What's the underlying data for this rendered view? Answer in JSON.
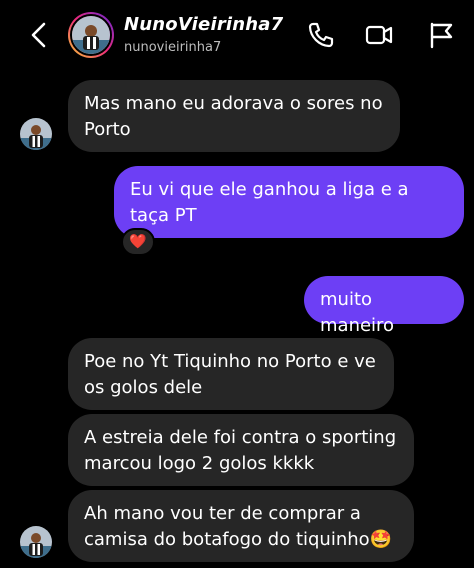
{
  "header": {
    "username": "NunoVieirinha7",
    "handle": "nunovieirinha7",
    "icons": [
      "back-chevron-icon",
      "phone-icon",
      "video-camera-icon",
      "flag-icon"
    ]
  },
  "messages": [
    {
      "side": "incoming",
      "text": "Mas mano eu adorava o sores no Porto"
    },
    {
      "side": "outgoing",
      "text": "Eu vi que ele ganhou a liga e a taça PT",
      "reaction": "❤️"
    },
    {
      "side": "outgoing",
      "text": "muito maneiro"
    },
    {
      "side": "incoming",
      "text": "Poe no Yt Tiquinho no Porto e ve os golos dele"
    },
    {
      "side": "incoming",
      "text": "A estreia dele foi contra o sporting marcou logo 2 golos kkkk"
    },
    {
      "side": "incoming",
      "text": "Ah mano vou ter de comprar a camisa do botafogo do tiquinho🤩"
    }
  ],
  "colors": {
    "background": "#000000",
    "incoming_bubble": "#262626",
    "outgoing_bubble": "#6d3ff5",
    "secondary_text": "#bdbdbd"
  }
}
